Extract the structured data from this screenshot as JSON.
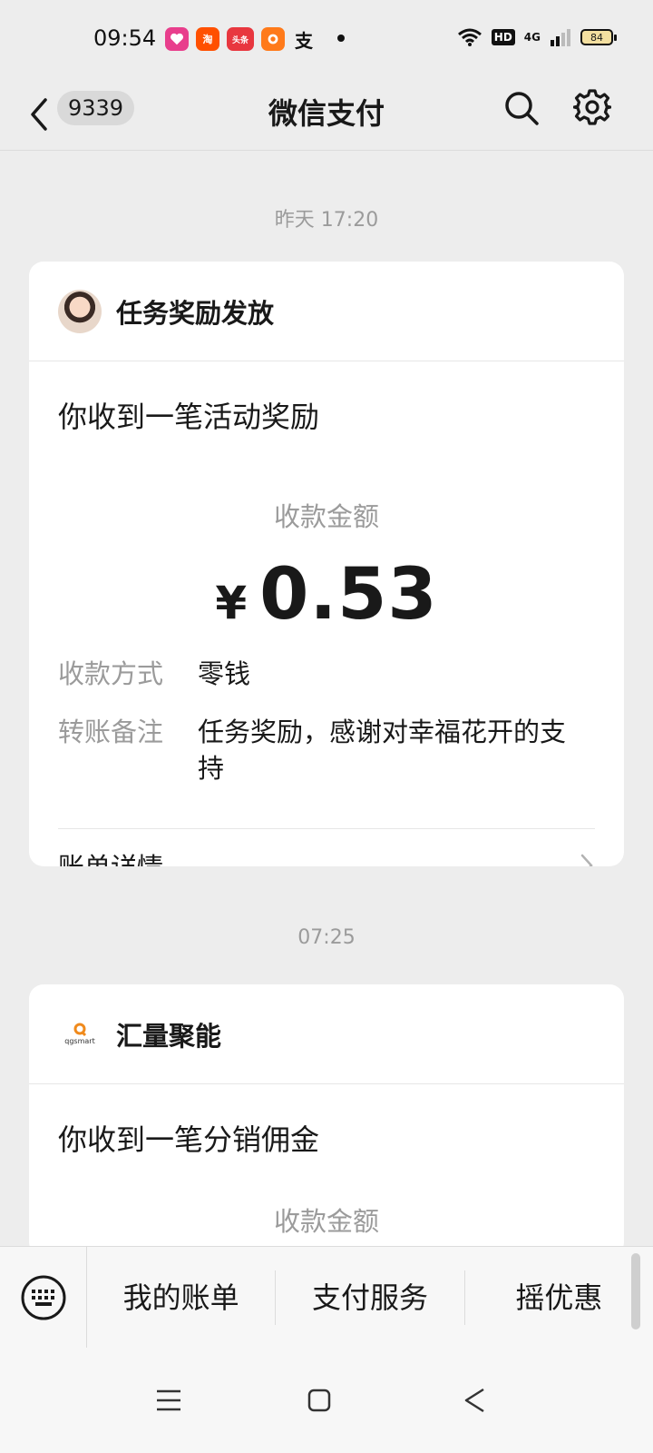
{
  "status_bar": {
    "time": "09:54",
    "app_icons": [
      {
        "name": "heart-app-icon",
        "text": "",
        "color": "#e83e8c"
      },
      {
        "name": "taobao-icon",
        "text": "淘",
        "color": "#ff5000"
      },
      {
        "name": "toutiao-icon",
        "text": "头条",
        "color": "#e8373f"
      },
      {
        "name": "fenqile-icon",
        "text": "",
        "color": "#ff7a1a"
      },
      {
        "name": "alipay-icon",
        "text": "支",
        "color": "#1677ff"
      }
    ],
    "network": "4G",
    "hd": "HD",
    "battery": "84"
  },
  "header": {
    "unread_count": "9339",
    "title": "微信支付"
  },
  "messages": [
    {
      "time": "昨天 17:20",
      "sender": "任务奖励发放",
      "headline": "你收到一笔活动奖励",
      "amount_label": "收款金额",
      "currency": "¥",
      "amount": "0.53",
      "details": [
        {
          "key": "收款方式",
          "value": "零钱"
        },
        {
          "key": "转账备注",
          "value": "任务奖励，感谢对幸福花开的支持"
        }
      ],
      "bill_link": "账单详情"
    },
    {
      "time": "07:25",
      "sender": "汇量聚能",
      "logo_text": "qgsmart",
      "headline": "你收到一笔分销佣金",
      "amount_label": "收款金额"
    }
  ],
  "bottom_menu": {
    "items": [
      "我的账单",
      "支付服务",
      "摇优惠"
    ]
  },
  "colors": {
    "background": "#ededed",
    "card": "#ffffff",
    "muted_text": "#9b9b9b",
    "logo_orange": "#f08a1c"
  }
}
